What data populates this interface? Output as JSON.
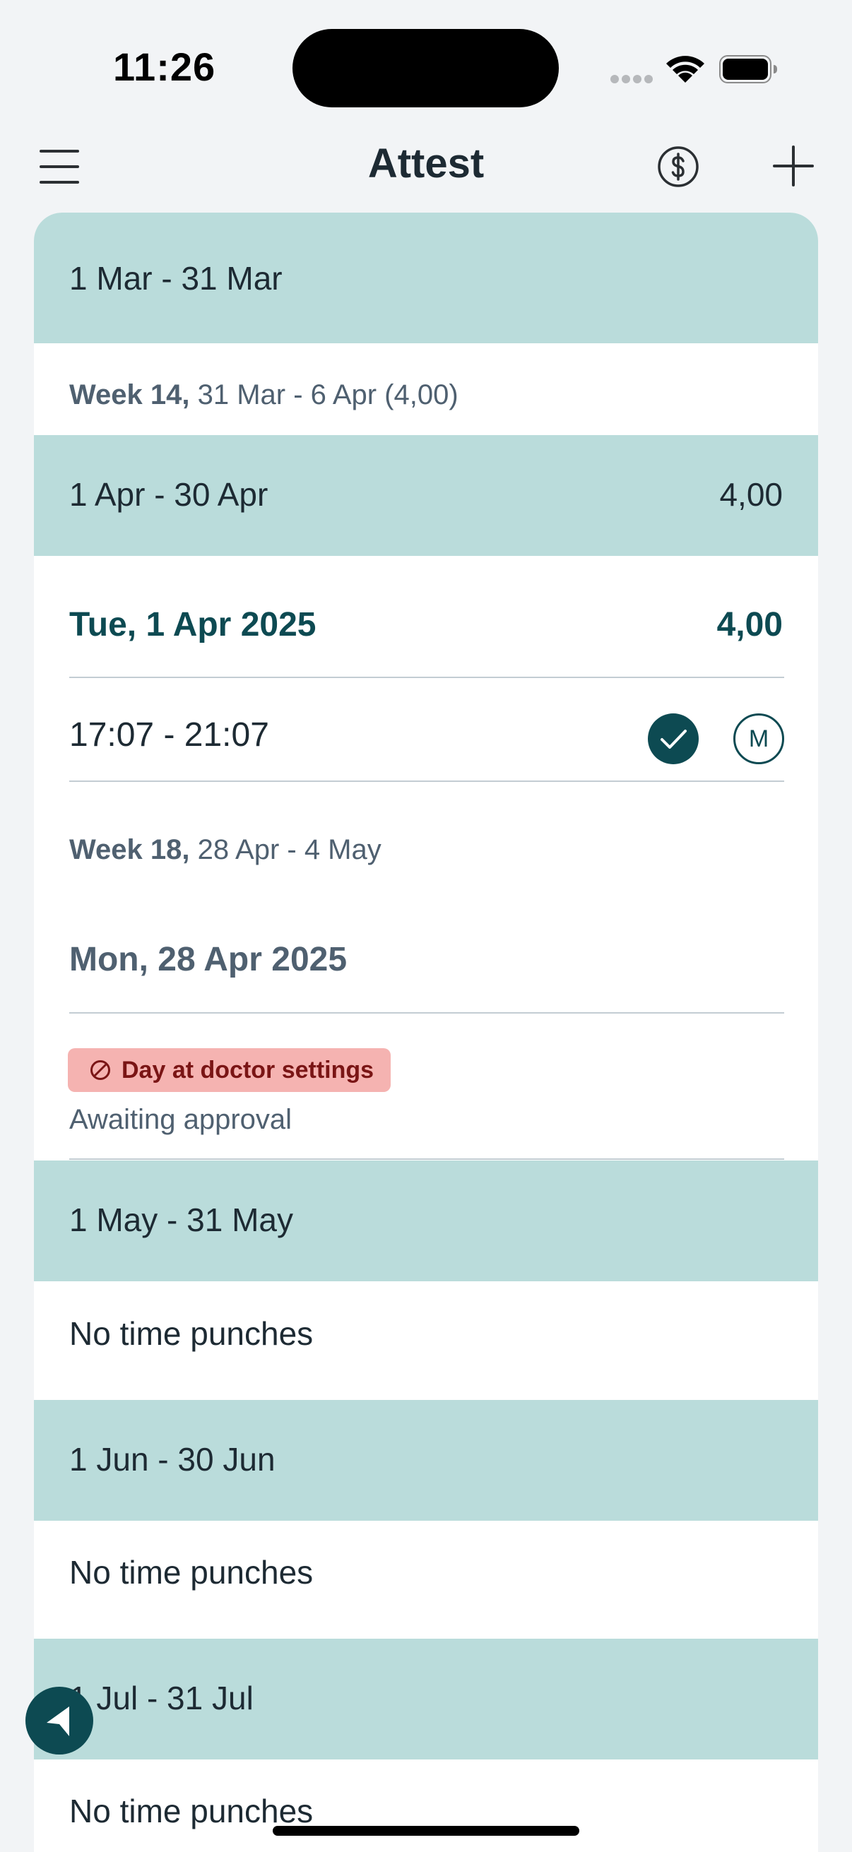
{
  "status_bar": {
    "time": "11:26"
  },
  "header": {
    "title": "Attest"
  },
  "periods": [
    {
      "label": "1 Mar - 31 Mar"
    },
    {
      "label": "1 Apr - 30 Apr",
      "total": "4,00"
    },
    {
      "label": "1 May - 31 May",
      "empty_text": "No time punches"
    },
    {
      "label": "1 Jun - 30 Jun",
      "empty_text": "No time punches"
    },
    {
      "label": "1 Jul - 31 Jul",
      "empty_text": "No time punches"
    }
  ],
  "weeks": [
    {
      "number": "Week 14,",
      "range": "31 Mar - 6 Apr (4,00)"
    },
    {
      "number": "Week 18,",
      "range": "28 Apr - 4 May"
    }
  ],
  "days": [
    {
      "title": "Tue, 1 Apr 2025",
      "total": "4,00",
      "punch_time": "17:07 - 21:07",
      "marker_letter": "M"
    },
    {
      "title": "Mon, 28 Apr 2025",
      "badge_label": "Day at doctor settings",
      "status": "Awaiting approval"
    }
  ],
  "colors": {
    "accent": "#0d4a52",
    "band": "#badcdb",
    "badge": "#f5b3b1"
  }
}
